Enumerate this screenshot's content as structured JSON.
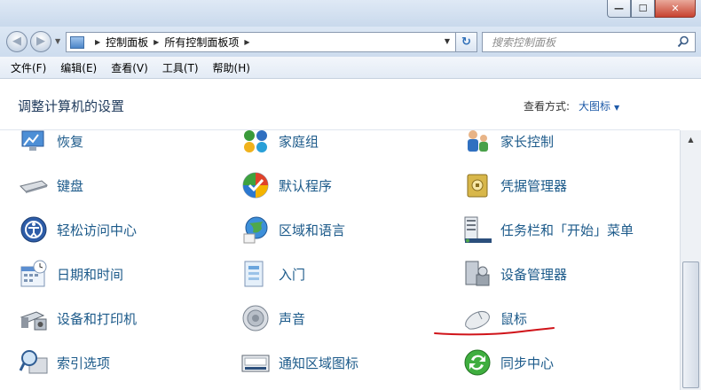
{
  "window": {
    "min_glyph": "—",
    "max_glyph": "☐",
    "close_glyph": "✕"
  },
  "address": {
    "crumbs": [
      "控制面板",
      "所有控制面板项"
    ],
    "search_placeholder": "搜索控制面板"
  },
  "menu": [
    "文件(F)",
    "编辑(E)",
    "查看(V)",
    "工具(T)",
    "帮助(H)"
  ],
  "header": {
    "title": "调整计算机的设置",
    "view_by_label": "查看方式:",
    "view_by_value": "大图标"
  },
  "items": [
    {
      "label": "恢复",
      "icon": "recovery-icon"
    },
    {
      "label": "家庭组",
      "icon": "homegroup-icon"
    },
    {
      "label": "家长控制",
      "icon": "parental-controls-icon"
    },
    {
      "label": "键盘",
      "icon": "keyboard-icon"
    },
    {
      "label": "默认程序",
      "icon": "default-programs-icon"
    },
    {
      "label": "凭据管理器",
      "icon": "credential-manager-icon"
    },
    {
      "label": "轻松访问中心",
      "icon": "ease-of-access-icon"
    },
    {
      "label": "区域和语言",
      "icon": "region-language-icon"
    },
    {
      "label": "任务栏和「开始」菜单",
      "icon": "taskbar-icon"
    },
    {
      "label": "日期和时间",
      "icon": "date-time-icon"
    },
    {
      "label": "入门",
      "icon": "getting-started-icon"
    },
    {
      "label": "设备管理器",
      "icon": "device-manager-icon"
    },
    {
      "label": "设备和打印机",
      "icon": "devices-printers-icon"
    },
    {
      "label": "声音",
      "icon": "sound-icon"
    },
    {
      "label": "鼠标",
      "icon": "mouse-icon"
    },
    {
      "label": "索引选项",
      "icon": "indexing-options-icon"
    },
    {
      "label": "通知区域图标",
      "icon": "notification-area-icon"
    },
    {
      "label": "同步中心",
      "icon": "sync-center-icon"
    }
  ],
  "colors": {
    "link": "#1c5a8a",
    "annotation": "#d0141a"
  }
}
